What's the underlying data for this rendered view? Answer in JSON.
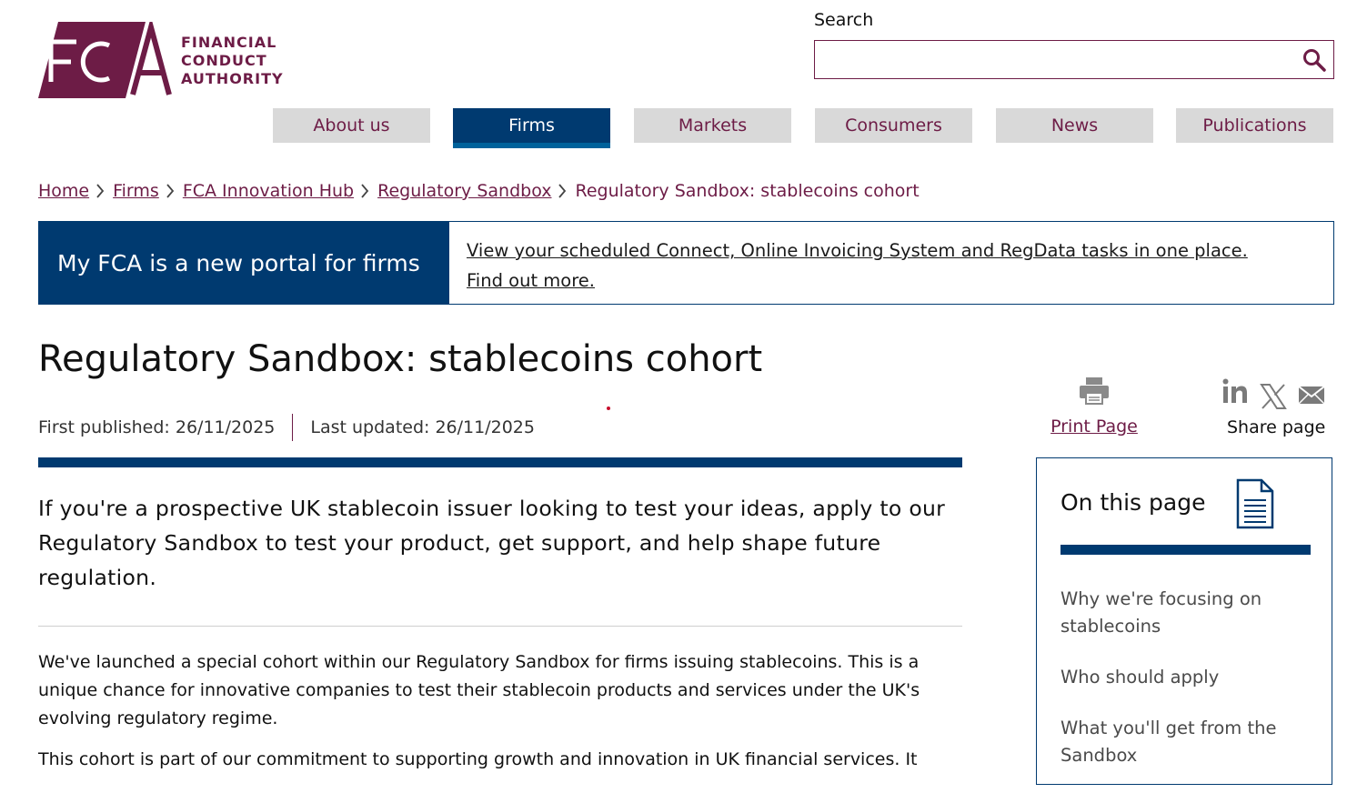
{
  "logo": {
    "letters": "FCA",
    "lines": [
      "FINANCIAL",
      "CONDUCT",
      "AUTHORITY"
    ]
  },
  "search": {
    "label": "Search",
    "value": "",
    "placeholder": ""
  },
  "nav": {
    "items": [
      {
        "label": "About us"
      },
      {
        "label": "Firms"
      },
      {
        "label": "Markets"
      },
      {
        "label": "Consumers"
      },
      {
        "label": "News"
      },
      {
        "label": "Publications"
      }
    ],
    "active": "Firms"
  },
  "breadcrumb": {
    "items": [
      "Home",
      "Firms",
      "FCA Innovation Hub",
      "Regulatory Sandbox"
    ],
    "current": "Regulatory Sandbox: stablecoins cohort"
  },
  "banner": {
    "heading": "My FCA is a new portal for firms",
    "link_line1": "View your scheduled Connect, Online Invoicing System and RegData tasks in one place.",
    "link_line2": "Find out more."
  },
  "page": {
    "title": "Regulatory Sandbox: stablecoins cohort",
    "first_published": "First published: 26/11/2025",
    "last_updated": "Last updated: 26/11/2025"
  },
  "actions": {
    "print_label": "Print Page",
    "share_label": "Share page",
    "share_icons": [
      "linkedin-icon",
      "x-icon",
      "email-icon"
    ]
  },
  "content": {
    "lead": "If you're a prospective UK stablecoin issuer looking to test your ideas, apply to our Regulatory Sandbox to test your product, get support, and help shape future regulation.",
    "paragraph1": "We've launched a special cohort within our Regulatory Sandbox for firms issuing stablecoins. This is a unique chance for innovative companies to test their stablecoin products and services under the UK's evolving regulatory regime.",
    "paragraph2": "This cohort is part of our commitment to supporting growth and innovation in UK financial services. It"
  },
  "toc": {
    "heading": "On this page",
    "links": [
      "Why we're focusing on stablecoins",
      "Who should apply",
      "What you'll get from the Sandbox"
    ]
  },
  "colors": {
    "brand_plum": "#6d1c46",
    "navy": "#003a70",
    "nav_grey": "#d9d9d9"
  }
}
